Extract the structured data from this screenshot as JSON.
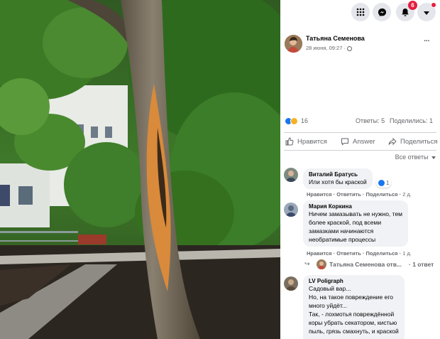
{
  "topbar": {
    "icons": [
      "menu-grid-icon",
      "messenger-icon",
      "bell-icon",
      "caret-down-icon"
    ],
    "notification_count": "6"
  },
  "post": {
    "author": "Татьяна Семенова",
    "date": "28 июня, 09:27 ·",
    "more": "···",
    "reactions_count": "16",
    "comments_count": "Ответы: 5",
    "shares_count": "Поделились: 1"
  },
  "actions": {
    "like": "Нравится",
    "answer": "Answer",
    "share": "Поделиться"
  },
  "sort_label": "Все ответы",
  "comments": [
    {
      "name": "Виталий Братусь",
      "text": "Или хотя бы краской",
      "reaction_count": "1",
      "like": "Нравится",
      "reply": "Ответить",
      "share": "Поделиться",
      "time": "2 д."
    },
    {
      "name": "Мария Коркина",
      "text": "Ничем замазывать не нужно, тем\nболее краской, под всеми\nзамазками начинаются\nнеобратимые процессы",
      "like": "Нравится",
      "reply": "Ответить",
      "share": "Поделиться",
      "time": "1 д."
    },
    {
      "name": "LV Poligraph",
      "text": "Садовый вар...\nНо, на такое повреждение его\nмного уйдёт...\nТак, - лохмотья повреждённой\nкоры убрать секатором, кистью\nпыль, грязь смахнуть, и краской"
    }
  ],
  "reply_preview": {
    "author": "Татьяна Семенова отв...",
    "count": "· 1 ответ"
  },
  "colors": {
    "link": "#65676b",
    "accent": "#1877f2",
    "badge": "#e41e3f"
  }
}
